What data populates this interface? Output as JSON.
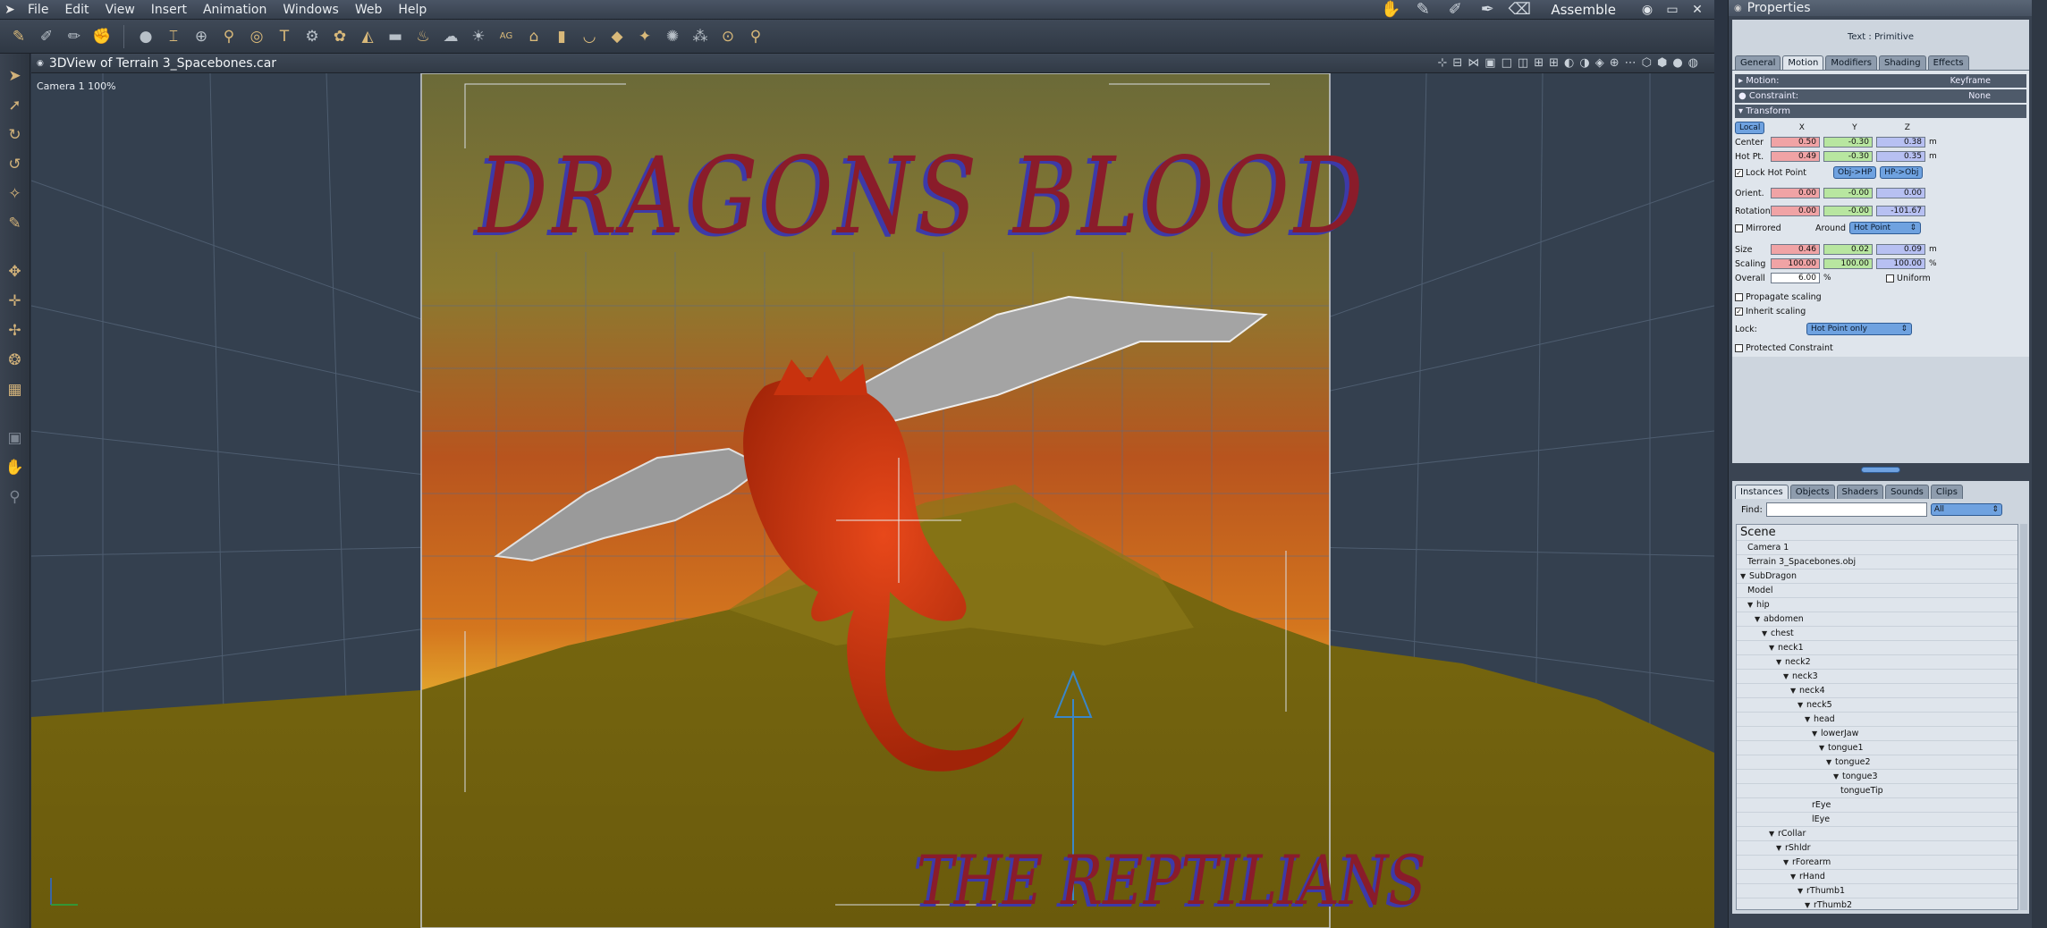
{
  "menubar": {
    "items": [
      "File",
      "Edit",
      "View",
      "Insert",
      "Animation",
      "Windows",
      "Web",
      "Help"
    ],
    "room": "Assemble",
    "window_controls": [
      "⊖",
      "▭",
      "✕"
    ]
  },
  "viewport": {
    "title": "3DView of Terrain 3_Spacebones.car",
    "camera_label": "Camera 1 100%",
    "title_text_main": "DRAGONS BLOOD",
    "title_text_sub": "THE REPTILIANS"
  },
  "properties": {
    "window_title": "Properties",
    "object_name": "Text : Primitive",
    "tabs": [
      "General",
      "Motion",
      "Modifiers",
      "Shading",
      "Effects"
    ],
    "motion": {
      "label": "Motion:",
      "value": "Keyframe"
    },
    "constraint": {
      "label": "Constraint:",
      "value": "None"
    },
    "transform_label": "Transform",
    "space": "Local",
    "axes": [
      "X",
      "Y",
      "Z"
    ],
    "center": {
      "label": "Center",
      "x": "0.50",
      "y": "-0.30",
      "z": "0.38",
      "unit": "m"
    },
    "hotpt": {
      "label": "Hot Pt.",
      "x": "0.49",
      "y": "-0.30",
      "z": "0.35",
      "unit": "m"
    },
    "lock_hot_point": "Lock Hot Point",
    "obj_hp": "Obj->HP",
    "hp_obj": "HP->Obj",
    "orient": {
      "label": "Orient.",
      "x": "0.00",
      "y": "-0.00",
      "z": "0.00"
    },
    "rotation": {
      "label": "Rotation",
      "x": "0.00",
      "y": "-0.00",
      "z": "-101.67"
    },
    "mirrored": "Mirrored",
    "around": "Around",
    "around_value": "Hot Point",
    "size": {
      "label": "Size",
      "x": "0.46",
      "y": "0.02",
      "z": "0.09",
      "unit": "m"
    },
    "scaling": {
      "label": "Scaling",
      "x": "100.00",
      "y": "100.00",
      "z": "100.00",
      "unit": "%"
    },
    "overall": {
      "label": "Overall",
      "value": "6.00",
      "unit": "%"
    },
    "uniform": "Uniform",
    "propagate": "Propagate scaling",
    "inherit": "Inherit scaling",
    "lock_label": "Lock:",
    "lock_value": "Hot Point only",
    "protected": "Protected Constraint"
  },
  "instances": {
    "tabs": [
      "Instances",
      "Objects",
      "Shaders",
      "Sounds",
      "Clips"
    ],
    "find_label": "Find:",
    "filter": "All",
    "tree": [
      {
        "label": "Scene",
        "depth": 0,
        "hdr": true
      },
      {
        "label": "Camera 1",
        "depth": 1
      },
      {
        "label": "Terrain 3_Spacebones.obj",
        "depth": 1
      },
      {
        "label": "SubDragon",
        "depth": 0,
        "tw": true
      },
      {
        "label": "Model",
        "depth": 1
      },
      {
        "label": "hip",
        "depth": 1,
        "tw": true
      },
      {
        "label": "abdomen",
        "depth": 2,
        "tw": true
      },
      {
        "label": "chest",
        "depth": 3,
        "tw": true
      },
      {
        "label": "neck1",
        "depth": 4,
        "tw": true
      },
      {
        "label": "neck2",
        "depth": 5,
        "tw": true
      },
      {
        "label": "neck3",
        "depth": 6,
        "tw": true
      },
      {
        "label": "neck4",
        "depth": 7,
        "tw": true
      },
      {
        "label": "neck5",
        "depth": 8,
        "tw": true
      },
      {
        "label": "head",
        "depth": 9,
        "tw": true
      },
      {
        "label": "lowerJaw",
        "depth": 10,
        "tw": true
      },
      {
        "label": "tongue1",
        "depth": 11,
        "tw": true
      },
      {
        "label": "tongue2",
        "depth": 12,
        "tw": true
      },
      {
        "label": "tongue3",
        "depth": 13,
        "tw": true
      },
      {
        "label": "tongueTip",
        "depth": 14
      },
      {
        "label": "rEye",
        "depth": 10
      },
      {
        "label": "lEye",
        "depth": 10
      },
      {
        "label": "rCollar",
        "depth": 4,
        "tw": true
      },
      {
        "label": "rShldr",
        "depth": 5,
        "tw": true
      },
      {
        "label": "rForearm",
        "depth": 6,
        "tw": true
      },
      {
        "label": "rHand",
        "depth": 7,
        "tw": true
      },
      {
        "label": "rThumb1",
        "depth": 8,
        "tw": true
      },
      {
        "label": "rThumb2",
        "depth": 9,
        "tw": true
      }
    ]
  }
}
